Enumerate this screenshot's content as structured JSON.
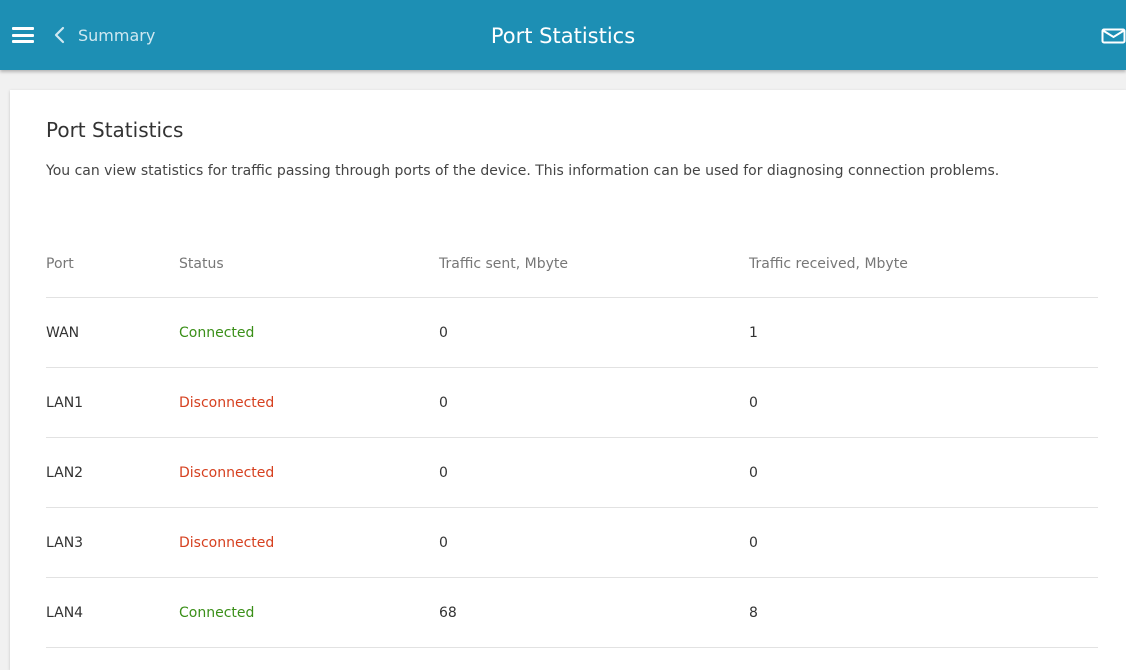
{
  "header": {
    "back_label": "Summary",
    "title": "Port Statistics"
  },
  "section": {
    "title": "Port Statistics",
    "description": "You can view statistics for traffic passing through ports of the device. This information can be used for diagnosing connection problems."
  },
  "table": {
    "columns": [
      "Port",
      "Status",
      "Traffic sent, Mbyte",
      "Traffic received, Mbyte"
    ],
    "rows": [
      {
        "port": "WAN",
        "status": "Connected",
        "sent": "0",
        "received": "1"
      },
      {
        "port": "LAN1",
        "status": "Disconnected",
        "sent": "0",
        "received": "0"
      },
      {
        "port": "LAN2",
        "status": "Disconnected",
        "sent": "0",
        "received": "0"
      },
      {
        "port": "LAN3",
        "status": "Disconnected",
        "sent": "0",
        "received": "0"
      },
      {
        "port": "LAN4",
        "status": "Connected",
        "sent": "68",
        "received": "8"
      }
    ]
  },
  "colors": {
    "header_bg": "#1d8fb4",
    "connected": "#3a8f18",
    "disconnected": "#d6401f"
  },
  "icons": [
    "menu-icon",
    "chevron-left-icon",
    "mail-icon"
  ]
}
